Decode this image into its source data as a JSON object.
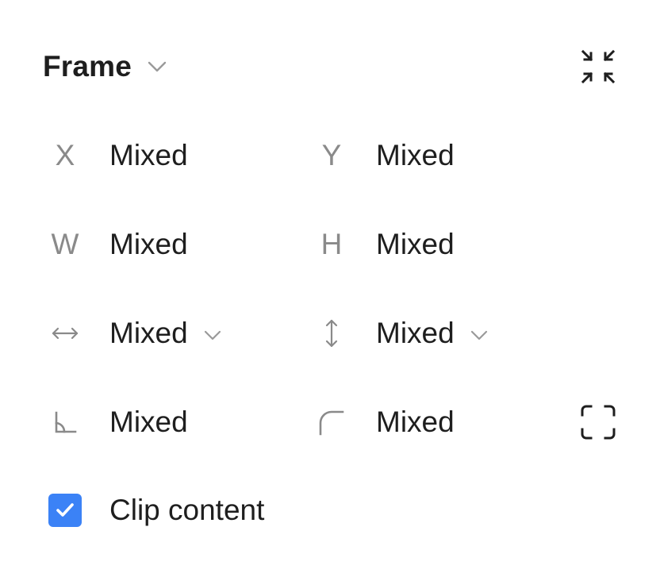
{
  "panel": {
    "title": "Frame",
    "title_chevron_icon": "chevron-down-icon",
    "collapse_icon": "collapse-arrows-icon"
  },
  "fields": {
    "x": {
      "label": "X",
      "value": "Mixed"
    },
    "y": {
      "label": "Y",
      "value": "Mixed"
    },
    "w": {
      "label": "W",
      "value": "Mixed"
    },
    "h": {
      "label": "H",
      "value": "Mixed"
    },
    "horizontal_resizing": {
      "icon": "horizontal-resize-icon",
      "value": "Mixed"
    },
    "vertical_resizing": {
      "icon": "vertical-resize-icon",
      "value": "Mixed"
    },
    "rotation": {
      "icon": "rotation-angle-icon",
      "value": "Mixed"
    },
    "corner_radius": {
      "icon": "corner-radius-icon",
      "value": "Mixed"
    },
    "independent_corners_icon": "independent-corners-icon"
  },
  "clip_content": {
    "label": "Clip content",
    "checked": true
  },
  "colors": {
    "accent": "#3b82f6",
    "text": "#1e1e1e",
    "muted": "#8a8a8a"
  }
}
